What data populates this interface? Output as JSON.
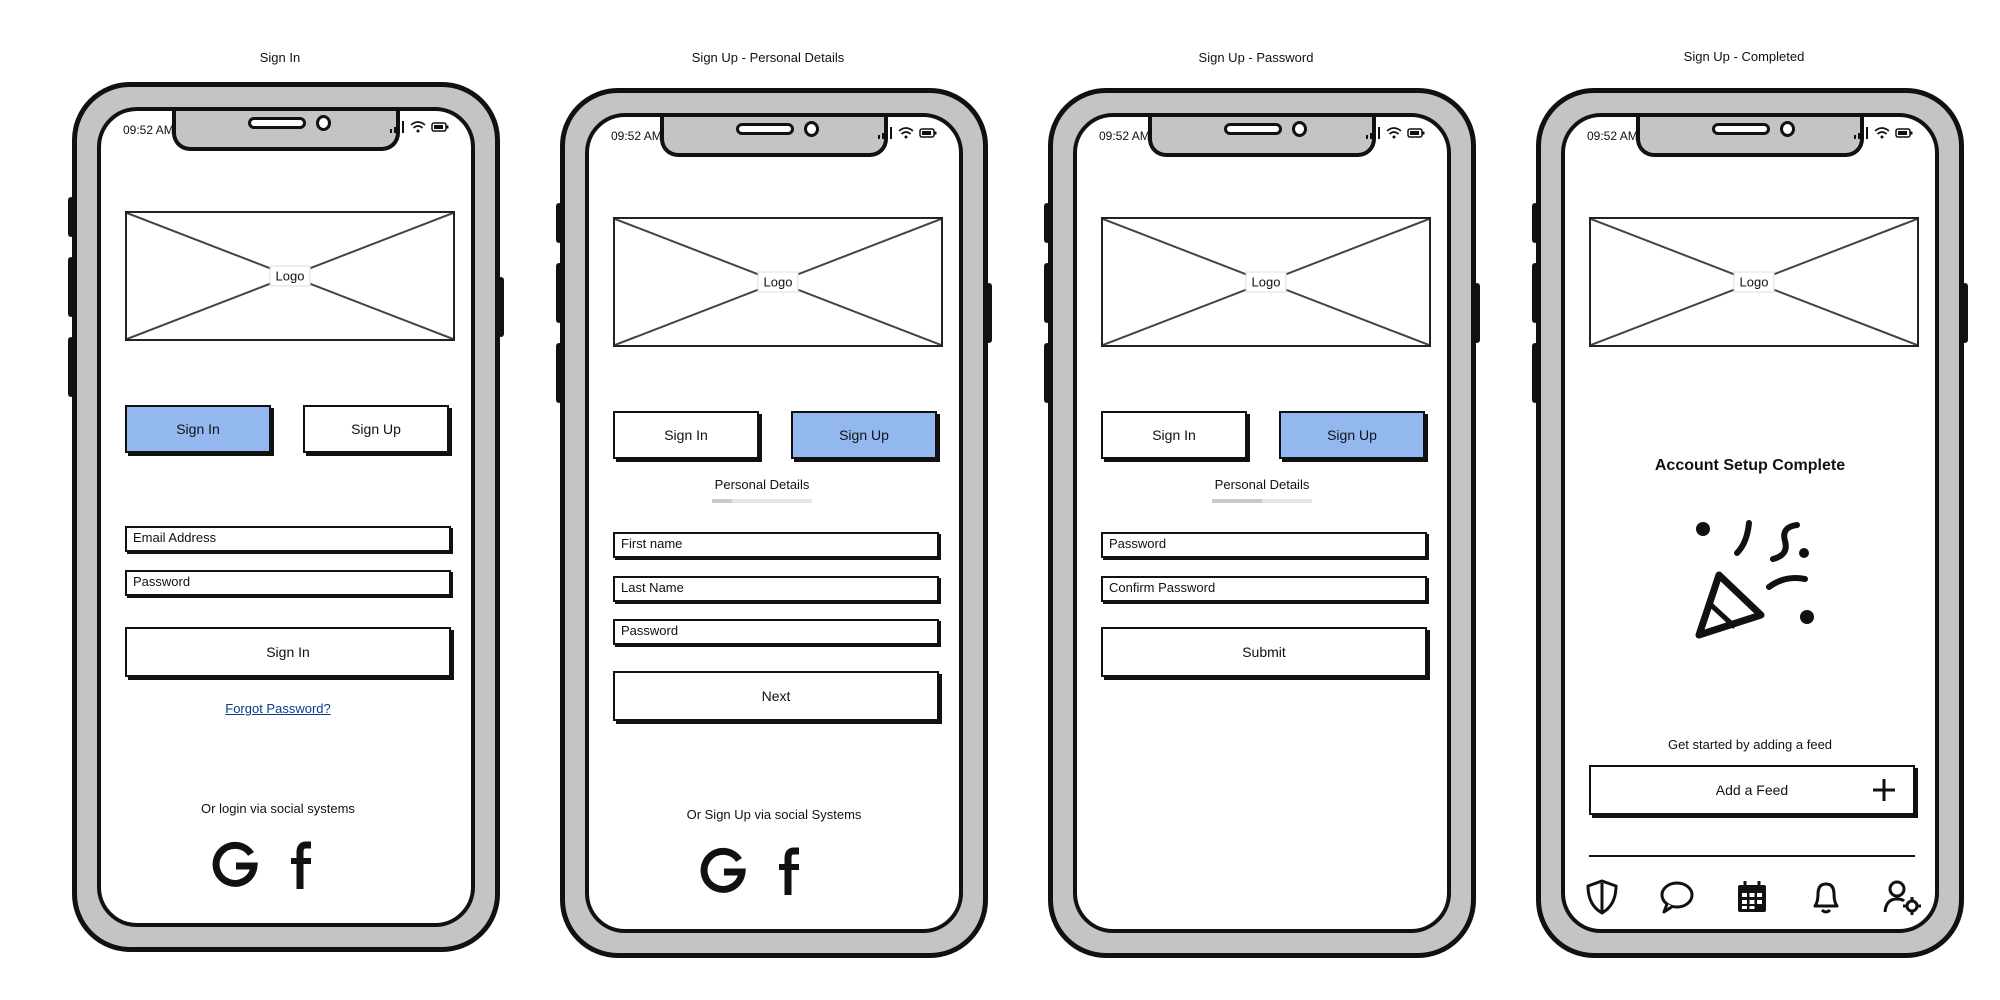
{
  "status_bar": {
    "time": "09:52 AM"
  },
  "logo": {
    "label": "Logo"
  },
  "screens": [
    {
      "title": "Sign In",
      "tabs": {
        "sign_in": "Sign In",
        "sign_up": "Sign Up",
        "active": "sign_in"
      },
      "fields": [
        "Email Address",
        "Password"
      ],
      "primary_button": "Sign In",
      "forgot_link": "Forgot Password?",
      "social_text": "Or login via social systems"
    },
    {
      "title": "Sign Up - Personal Details",
      "tabs": {
        "sign_in": "Sign In",
        "sign_up": "Sign Up",
        "active": "sign_up"
      },
      "step_label": "Personal Details",
      "progress": 0.2,
      "fields": [
        "First name",
        "Last Name",
        "Password"
      ],
      "primary_button": "Next",
      "social_text": "Or Sign Up via social Systems"
    },
    {
      "title": "Sign Up - Password",
      "tabs": {
        "sign_in": "Sign In",
        "sign_up": "Sign Up",
        "active": "sign_up"
      },
      "step_label": "Personal Details",
      "progress": 0.5,
      "fields": [
        "Password",
        "Confirm Password"
      ],
      "primary_button": "Submit"
    },
    {
      "title": "Sign Up - Completed",
      "heading": "Account Setup Complete",
      "subtext": "Get started by adding a feed",
      "add_button": "Add a Feed",
      "nav_icons": [
        "shield-icon",
        "chat-icon",
        "calendar-icon",
        "bell-icon",
        "user-settings-icon"
      ]
    }
  ],
  "colors": {
    "active_tab": "#93b8f0",
    "frame": "#c4c4c4",
    "link": "#0b3b8c"
  }
}
